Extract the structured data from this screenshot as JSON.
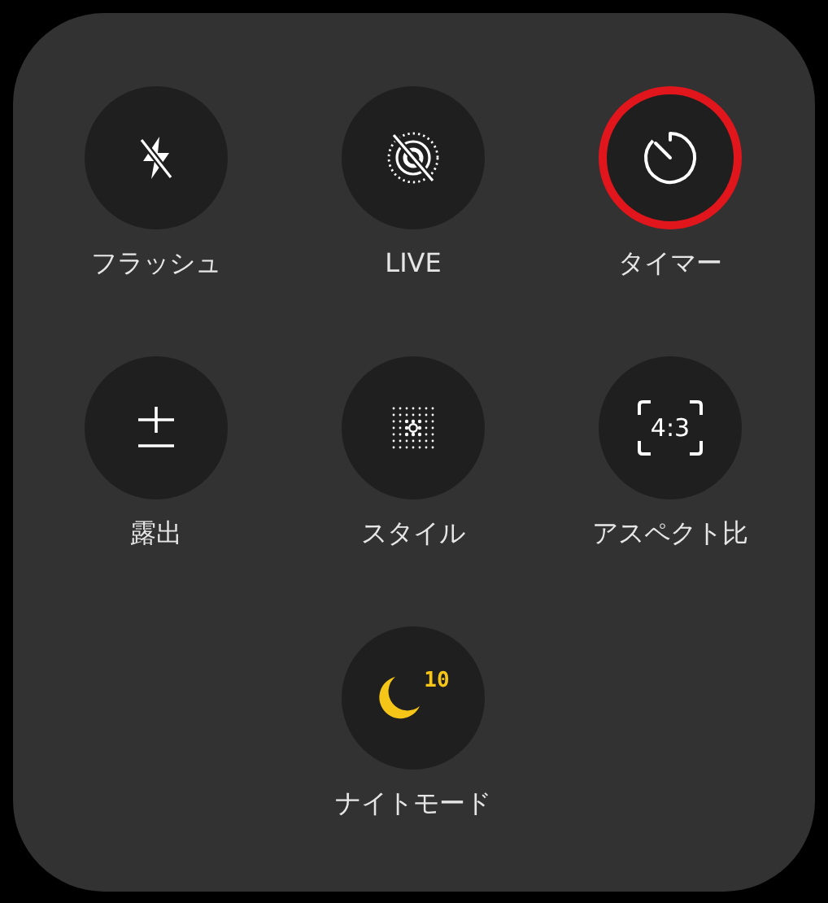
{
  "controls": [
    {
      "kind": "flash",
      "label": "フラッシュ",
      "active": false,
      "highlighted": false
    },
    {
      "kind": "live",
      "label": "LIVE",
      "active": false,
      "highlighted": false
    },
    {
      "kind": "timer",
      "label": "タイマー",
      "active": false,
      "highlighted": true
    },
    {
      "kind": "exposure",
      "label": "露出",
      "active": false,
      "highlighted": false
    },
    {
      "kind": "style",
      "label": "スタイル",
      "active": false,
      "highlighted": false
    },
    {
      "kind": "aspect",
      "label": "アスペクト比",
      "badge": "4:3",
      "active": false,
      "highlighted": false
    },
    {
      "kind": "night",
      "label": "ナイトモード",
      "badge": "10",
      "active": true,
      "highlighted": false
    }
  ]
}
